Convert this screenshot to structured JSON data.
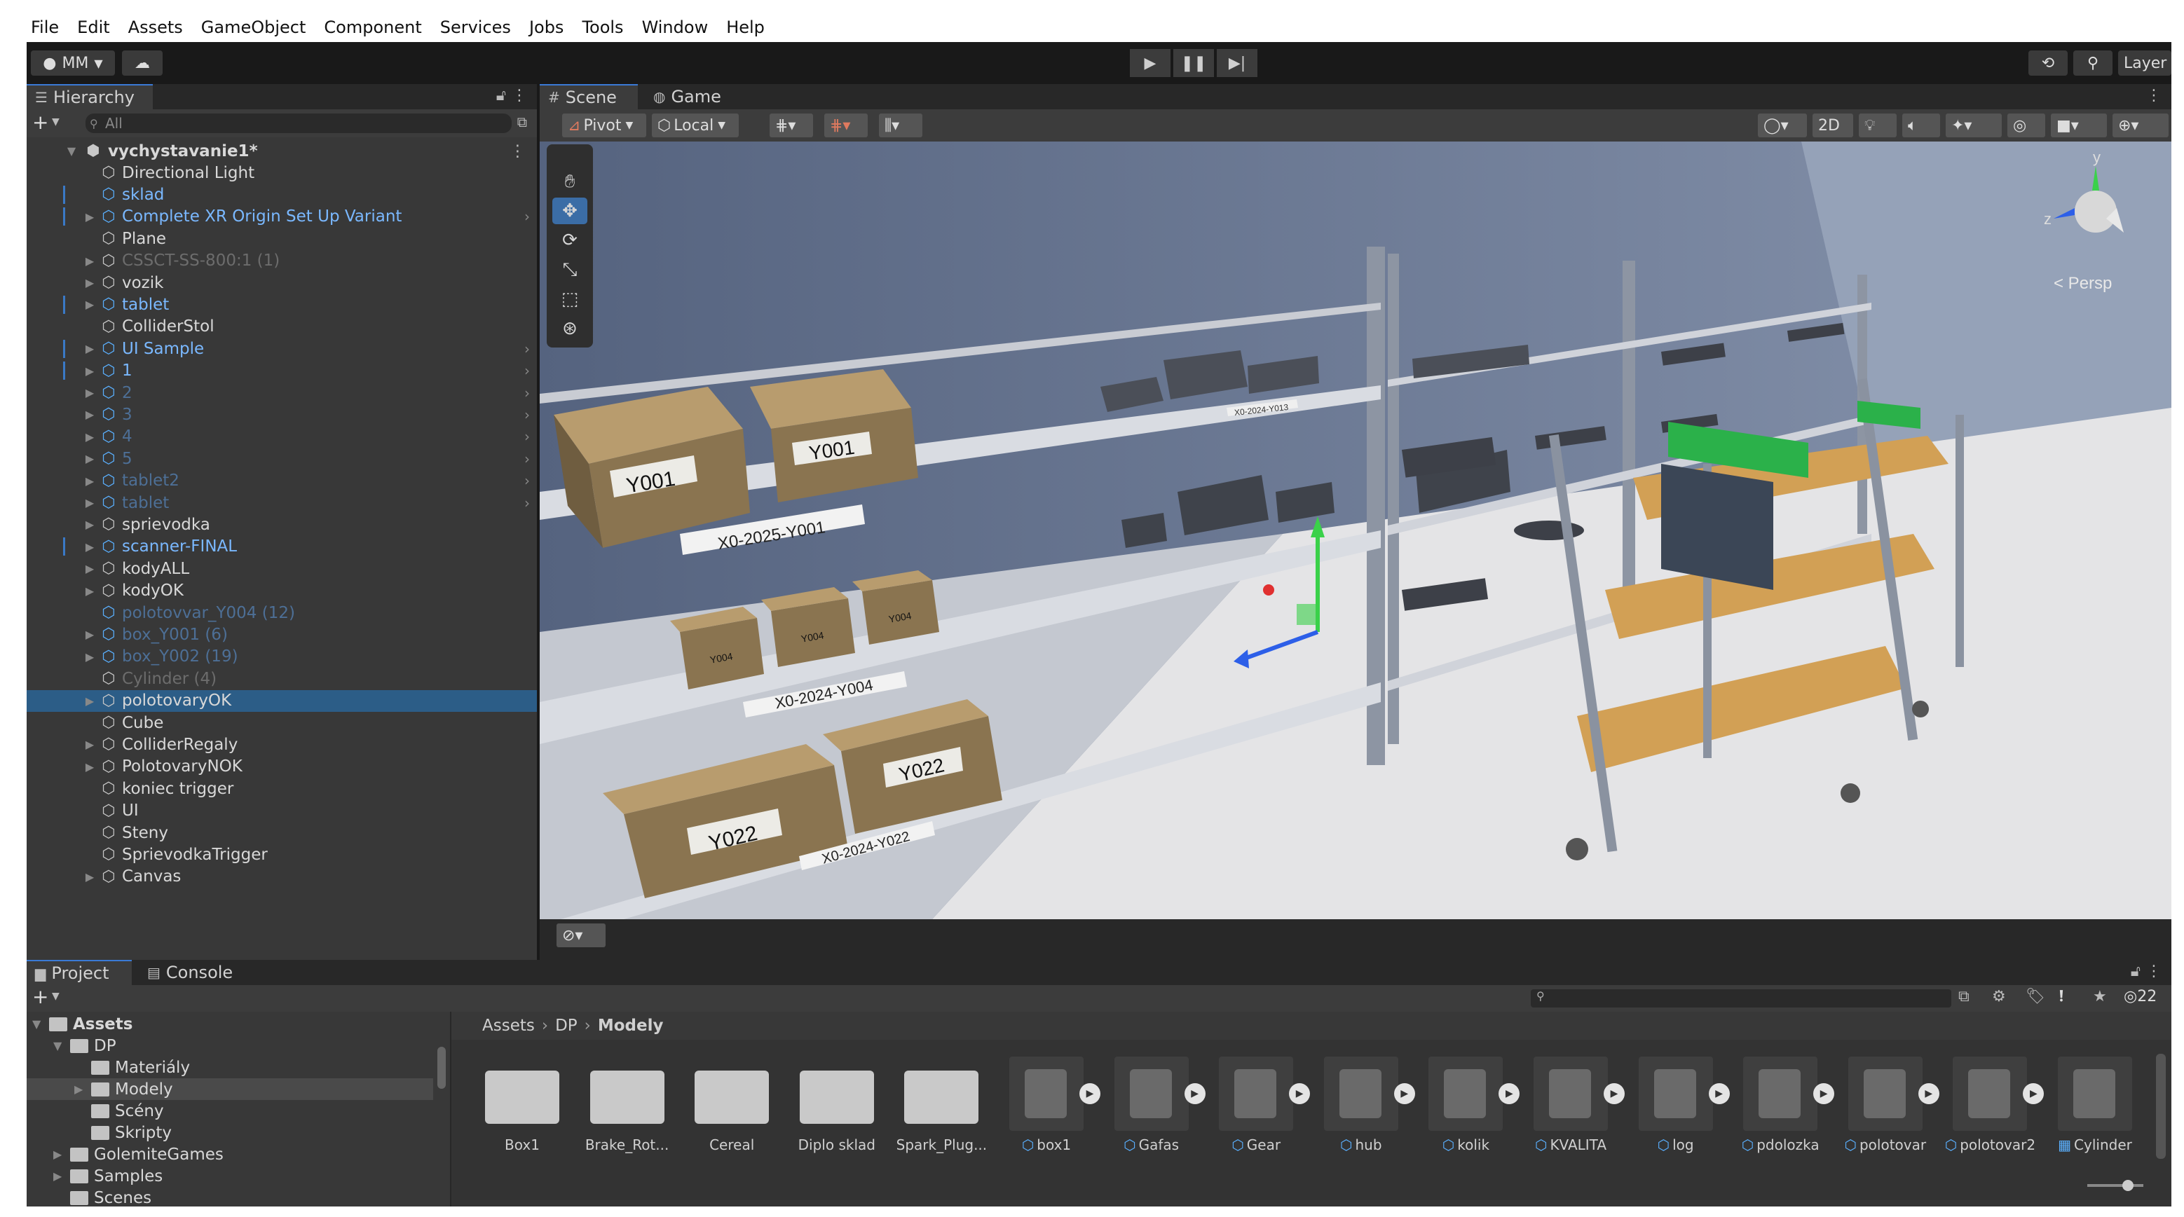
{
  "menu": [
    "File",
    "Edit",
    "Assets",
    "GameObject",
    "Component",
    "Services",
    "Jobs",
    "Tools",
    "Window",
    "Help"
  ],
  "toolbar": {
    "account": "MM",
    "layers": "Layer"
  },
  "hierarchy": {
    "tab_label": "Hierarchy",
    "search_placeholder": "All",
    "scene_name": "vychystavanie1*",
    "items": [
      {
        "label": "Directional Light",
        "type": "object",
        "depth": 1
      },
      {
        "label": "sklad",
        "type": "prefab",
        "depth": 1
      },
      {
        "label": "Complete XR Origin Set Up Variant",
        "type": "prefab",
        "depth": 1,
        "expandable": true,
        "arrow": true
      },
      {
        "label": "Plane",
        "type": "object",
        "depth": 1
      },
      {
        "label": "CSSCT-SS-800:1 (1)",
        "type": "object",
        "depth": 1,
        "expandable": true,
        "dim": true
      },
      {
        "label": "vozik",
        "type": "object",
        "depth": 1,
        "expandable": true
      },
      {
        "label": "tablet",
        "type": "prefab",
        "depth": 1,
        "expandable": true
      },
      {
        "label": "ColliderStol",
        "type": "object",
        "depth": 1
      },
      {
        "label": "UI Sample",
        "type": "prefab",
        "depth": 1,
        "expandable": true,
        "arrow": true
      },
      {
        "label": "1",
        "type": "prefab",
        "depth": 1,
        "expandable": true,
        "arrow": true
      },
      {
        "label": "2",
        "type": "prefab",
        "depth": 1,
        "expandable": true,
        "arrow": true,
        "dim": true
      },
      {
        "label": "3",
        "type": "prefab",
        "depth": 1,
        "expandable": true,
        "arrow": true,
        "dim": true
      },
      {
        "label": "4",
        "type": "prefab",
        "depth": 1,
        "expandable": true,
        "arrow": true,
        "dim": true
      },
      {
        "label": "5",
        "type": "prefab",
        "depth": 1,
        "expandable": true,
        "arrow": true,
        "dim": true
      },
      {
        "label": "tablet2",
        "type": "prefab",
        "depth": 1,
        "expandable": true,
        "arrow": true,
        "dim": true
      },
      {
        "label": "tablet",
        "type": "prefab",
        "depth": 1,
        "expandable": true,
        "arrow": true,
        "dim": true
      },
      {
        "label": "sprievodka",
        "type": "object",
        "depth": 1,
        "expandable": true
      },
      {
        "label": "scanner-FINAL",
        "type": "prefab",
        "depth": 1,
        "expandable": true
      },
      {
        "label": "kodyALL",
        "type": "object",
        "depth": 1,
        "expandable": true
      },
      {
        "label": "kodyOK",
        "type": "object",
        "depth": 1,
        "expandable": true
      },
      {
        "label": "polotovvar_Y004 (12)",
        "type": "prefab",
        "depth": 1,
        "dim": true
      },
      {
        "label": "box_Y001 (6)",
        "type": "prefab",
        "depth": 1,
        "expandable": true,
        "dim": true
      },
      {
        "label": "box_Y002 (19)",
        "type": "prefab",
        "depth": 1,
        "expandable": true,
        "dim": true
      },
      {
        "label": "Cylinder (4)",
        "type": "object",
        "depth": 1,
        "dim": true
      },
      {
        "label": "polotovaryOK",
        "type": "object",
        "depth": 1,
        "expandable": true,
        "selected": true
      },
      {
        "label": "Cube",
        "type": "object",
        "depth": 1
      },
      {
        "label": "ColliderRegaly",
        "type": "object",
        "depth": 1,
        "expandable": true
      },
      {
        "label": "PolotovaryNOK",
        "type": "object",
        "depth": 1,
        "expandable": true
      },
      {
        "label": "koniec trigger",
        "type": "object",
        "depth": 1
      },
      {
        "label": "UI",
        "type": "object",
        "depth": 1
      },
      {
        "label": "Steny",
        "type": "object",
        "depth": 1
      },
      {
        "label": "SprievodkaTrigger",
        "type": "object",
        "depth": 1
      },
      {
        "label": "Canvas",
        "type": "object",
        "depth": 1,
        "expandable": true
      }
    ]
  },
  "scene": {
    "tabs": [
      "Scene",
      "Game"
    ],
    "pivot": "Pivot",
    "local": "Local",
    "mode_2d": "2D",
    "persp": "< Persp",
    "gizmo_axes": {
      "y": "y",
      "z": "z"
    },
    "labels": {
      "box1a": "Y001",
      "box1b": "Y001",
      "shelf1": "X0-2025-Y001",
      "box4a": "Y004",
      "box4b": "Y004",
      "box4c": "Y004",
      "shelf4": "X0-2024-Y004",
      "box22a": "Y022",
      "box22b": "Y022",
      "shelf22": "X0-2024-Y022",
      "shelf13": "X0-2024-Y013"
    }
  },
  "project": {
    "tabs": [
      "Project",
      "Console"
    ],
    "hidden_count": "22",
    "tree": [
      {
        "label": "Assets",
        "depth": 0,
        "bold": true,
        "expanded": true
      },
      {
        "label": "DP",
        "depth": 1,
        "expanded": true
      },
      {
        "label": "Materiály",
        "depth": 2
      },
      {
        "label": "Modely",
        "depth": 2,
        "selected": true,
        "expandable": true
      },
      {
        "label": "Scény",
        "depth": 2
      },
      {
        "label": "Skripty",
        "depth": 2
      },
      {
        "label": "GolemiteGames",
        "depth": 1,
        "expandable": true
      },
      {
        "label": "Samples",
        "depth": 1,
        "expandable": true
      },
      {
        "label": "Scenes",
        "depth": 1
      }
    ],
    "breadcrumb": [
      "Assets",
      "DP",
      "Modely"
    ],
    "assets": [
      {
        "name": "Box1",
        "kind": "folder"
      },
      {
        "name": "Brake_Rot...",
        "kind": "folder"
      },
      {
        "name": "Cereal",
        "kind": "folder"
      },
      {
        "name": "Diplo sklad",
        "kind": "folder"
      },
      {
        "name": "Spark_Plug...",
        "kind": "folder"
      },
      {
        "name": "box1",
        "kind": "model"
      },
      {
        "name": "Gafas",
        "kind": "model"
      },
      {
        "name": "Gear",
        "kind": "model"
      },
      {
        "name": "hub",
        "kind": "model"
      },
      {
        "name": "kolik",
        "kind": "model"
      },
      {
        "name": "KVALITA",
        "kind": "model"
      },
      {
        "name": "log",
        "kind": "model"
      },
      {
        "name": "pdolozka",
        "kind": "model"
      },
      {
        "name": "polotovar",
        "kind": "model"
      },
      {
        "name": "polotovar2",
        "kind": "model"
      },
      {
        "name": "Cylinder",
        "kind": "mesh"
      }
    ]
  },
  "colors": {
    "selection": "#2c5d87",
    "prefab_blue": "#7ab8ff",
    "panel": "#383838",
    "toolbar": "#191919",
    "cart_wood": "#d2a055",
    "cart_handle": "#2bb14a",
    "gizmo_green": "#3ad14a",
    "gizmo_blue": "#2d5fe8",
    "gizmo_red": "#e03030"
  }
}
